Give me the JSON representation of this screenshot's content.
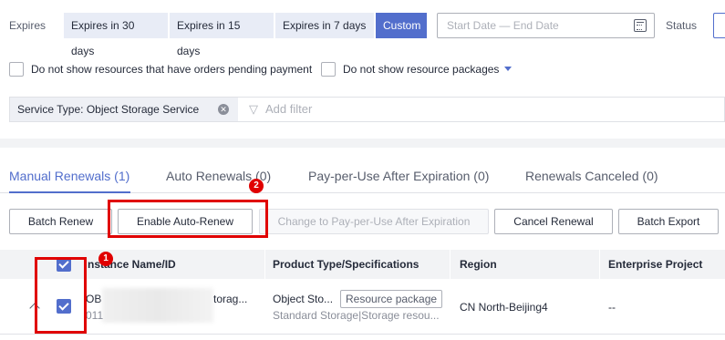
{
  "filters": {
    "expires_label": "Expires",
    "expires_options": [
      "Expires in 30 days",
      "Expires in 15 days",
      "Expires in 7 days",
      "Custom"
    ],
    "active_expires": "Custom",
    "date_range_placeholder": "Start Date — End Date",
    "status_label": "Status",
    "hide_pending_orders_label": "Do not show resources that have orders pending payment",
    "hide_resource_packages_label": "Do not show resource packages",
    "active_filter_tag": "Service Type: Object Storage Service",
    "add_filter_placeholder": "Add filter"
  },
  "tabs": [
    {
      "label": "Manual Renewals (1)",
      "active": true
    },
    {
      "label": "Auto Renewals (0)",
      "active": false
    },
    {
      "label": "Pay-per-Use After Expiration (0)",
      "active": false
    },
    {
      "label": "Renewals Canceled (0)",
      "active": false
    }
  ],
  "actions": {
    "batch_renew": "Batch Renew",
    "enable_auto_renew": "Enable Auto-Renew",
    "change_to_ppu": "Change to Pay-per-Use After Expiration",
    "cancel_renewal": "Cancel Renewal",
    "batch_export": "Batch Export"
  },
  "annotations": {
    "badge_1": "1",
    "badge_2": "2"
  },
  "table": {
    "columns": [
      "Instance Name/ID",
      "Product Type/Specifications",
      "Region",
      "Enterprise Project"
    ],
    "header_name_visible": "nstance Name/ID",
    "rows": [
      {
        "checked": true,
        "name_prefix": "OB",
        "name_suffix": "torag...",
        "id_prefix": "011",
        "product_type": "Object Sto...",
        "product_tag": "Resource package",
        "specs": "Standard Storage|Storage resou...",
        "region": "CN North-Beijing4",
        "enterprise_project": "--"
      }
    ]
  },
  "colors": {
    "accent": "#526ecc",
    "highlight": "#e00000"
  }
}
